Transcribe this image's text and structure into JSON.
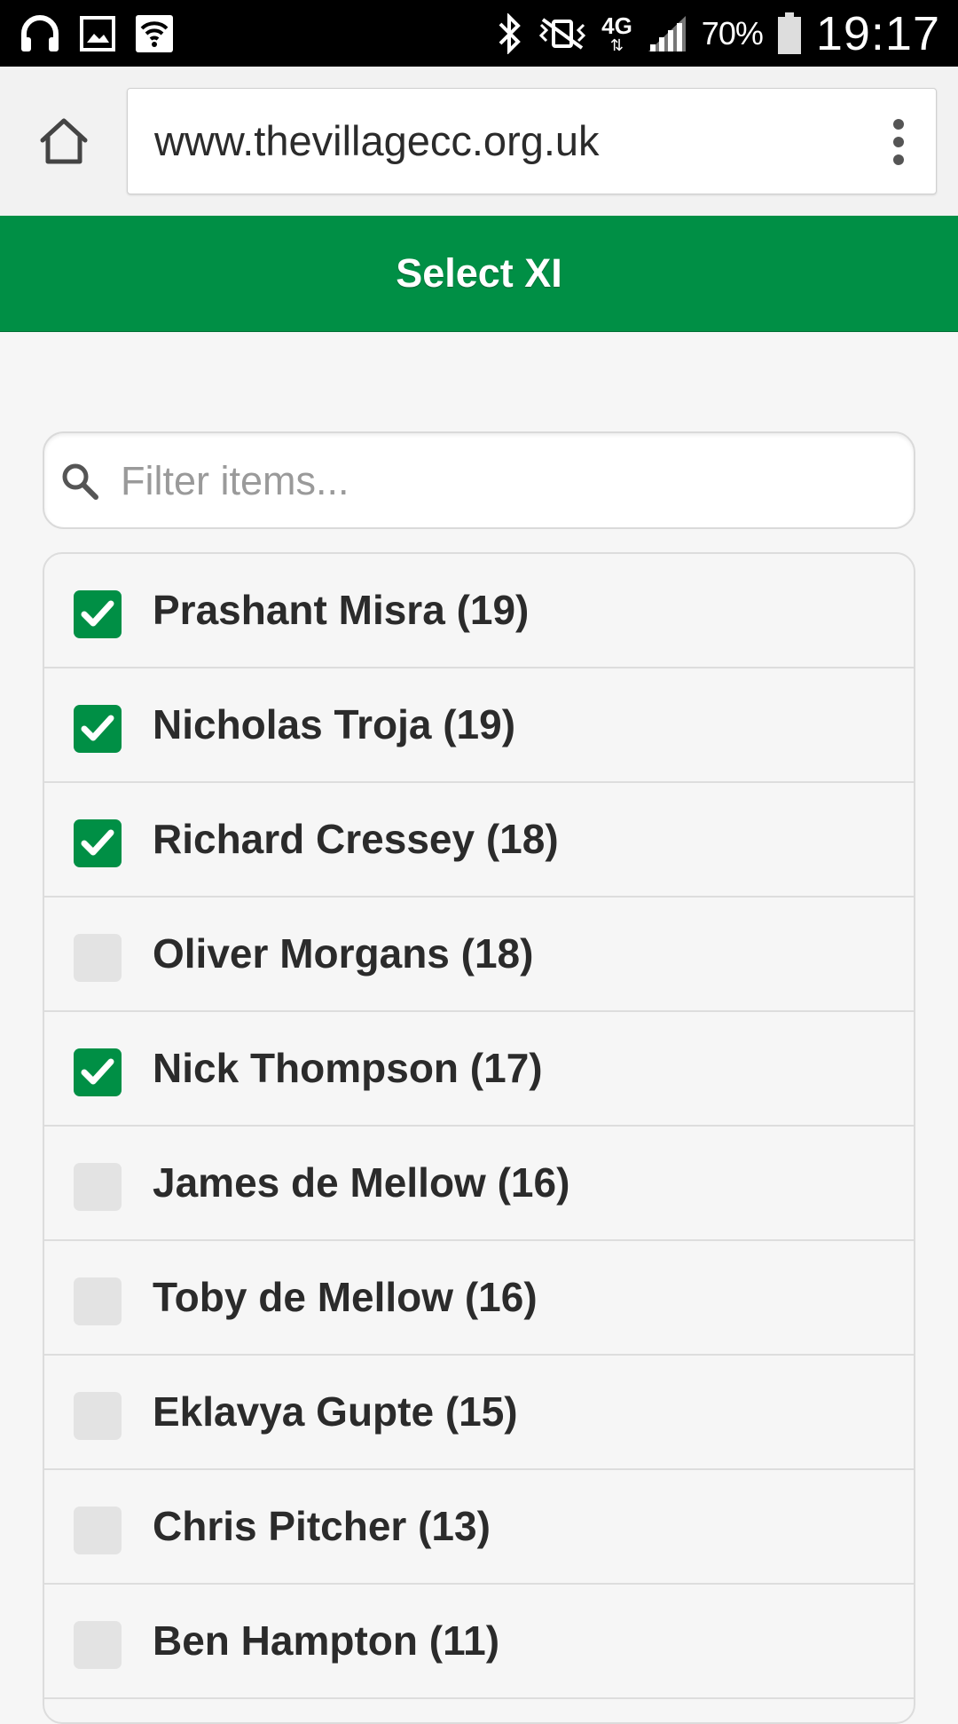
{
  "status_bar": {
    "battery_percent": "70%",
    "time": "19:17",
    "network_type": "4G",
    "icons": [
      "headphones-icon",
      "image-icon",
      "wifi-box-icon",
      "bluetooth-icon",
      "vibrate-mute-icon",
      "4g-data-icon",
      "signal-icon",
      "battery-icon"
    ]
  },
  "browser": {
    "url": "www.thevillagecc.org.uk",
    "home_icon": "home-icon",
    "menu_icon": "more-vertical-icon"
  },
  "header": {
    "title": "Select XI",
    "color": "#008f45"
  },
  "filter": {
    "placeholder": "Filter items...",
    "value": "",
    "icon": "search-icon"
  },
  "players": [
    {
      "label": "Prashant Misra (19)",
      "checked": true
    },
    {
      "label": "Nicholas Troja (19)",
      "checked": true
    },
    {
      "label": "Richard Cressey (18)",
      "checked": true
    },
    {
      "label": "Oliver Morgans (18)",
      "checked": false
    },
    {
      "label": "Nick Thompson (17)",
      "checked": true
    },
    {
      "label": "James de Mellow (16)",
      "checked": false
    },
    {
      "label": "Toby de Mellow (16)",
      "checked": false
    },
    {
      "label": "Eklavya Gupte (15)",
      "checked": false
    },
    {
      "label": "Chris Pitcher (13)",
      "checked": false
    },
    {
      "label": "Ben Hampton (11)",
      "checked": false
    }
  ]
}
